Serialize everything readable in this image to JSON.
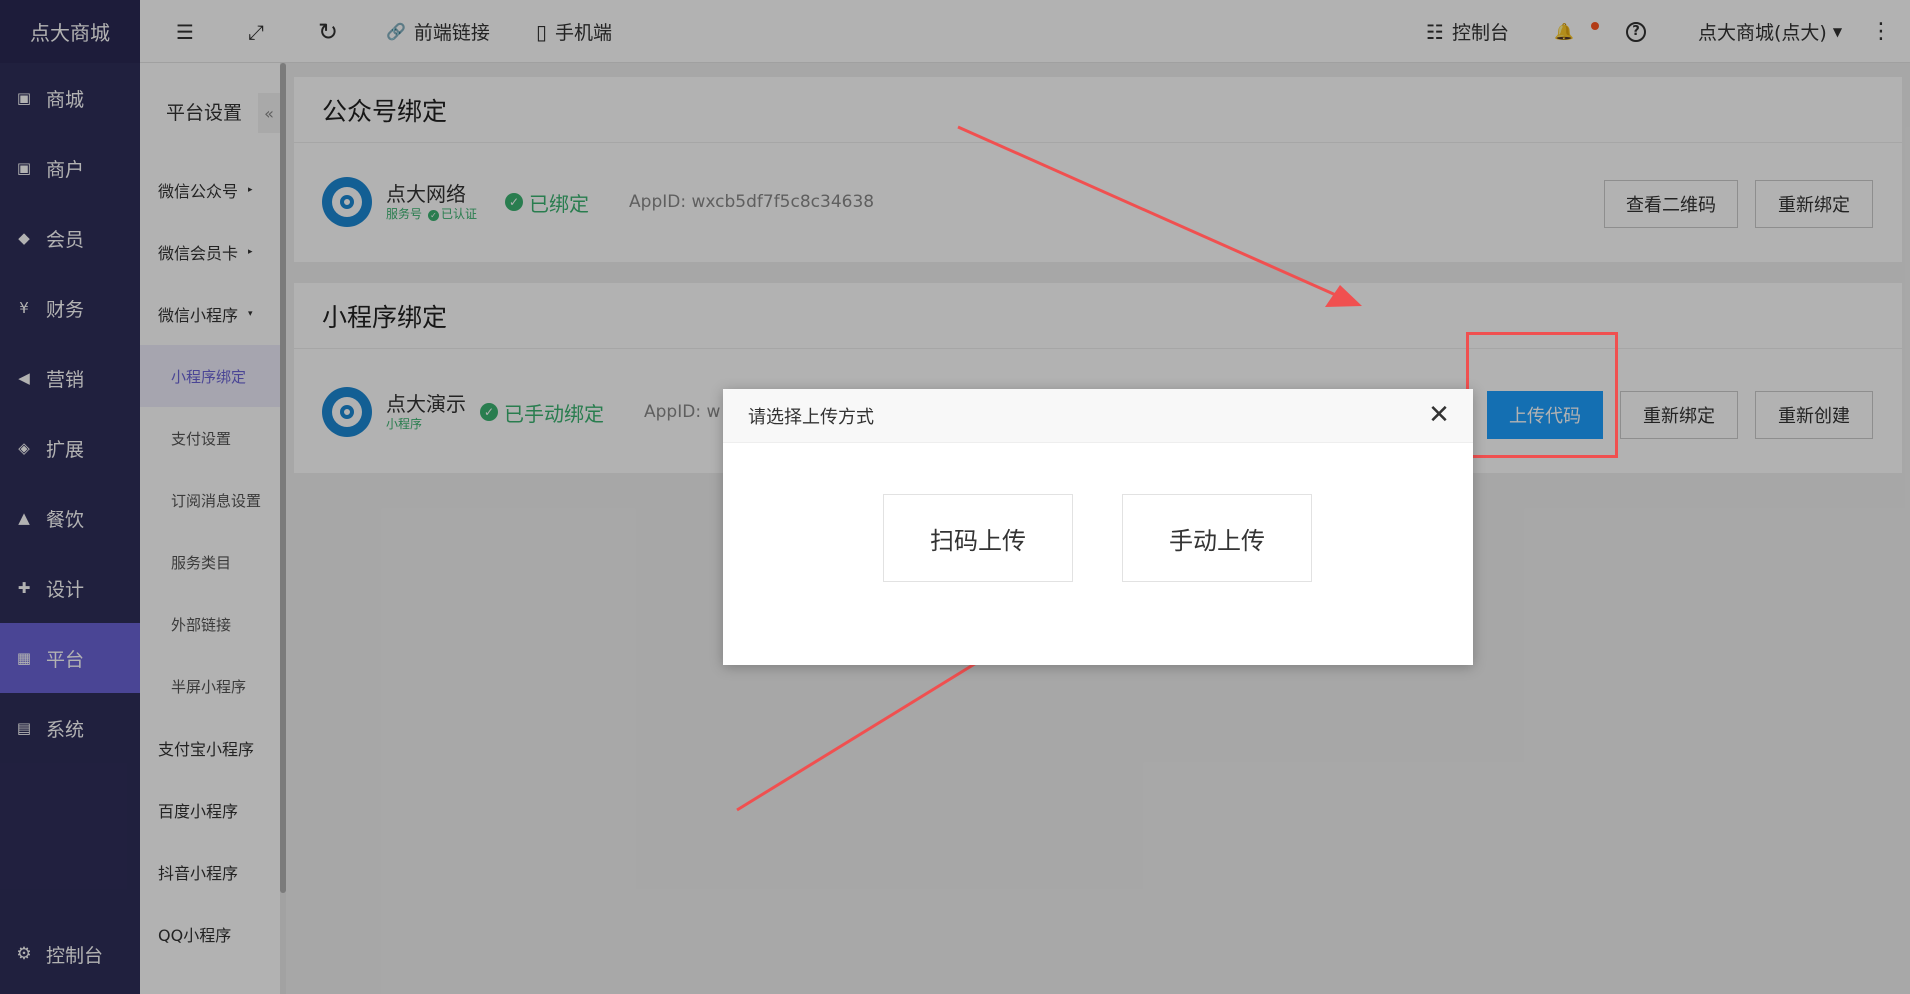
{
  "app": {
    "brand": "点大商城"
  },
  "leftnav": {
    "items": [
      {
        "label": "商城",
        "icon": "store-icon",
        "glyph": "▣"
      },
      {
        "label": "商户",
        "icon": "merchant-icon",
        "glyph": "▣"
      },
      {
        "label": "会员",
        "icon": "member-icon",
        "glyph": "◆"
      },
      {
        "label": "财务",
        "icon": "finance-icon",
        "glyph": "¥"
      },
      {
        "label": "营销",
        "icon": "megaphone-icon",
        "glyph": "◀"
      },
      {
        "label": "扩展",
        "icon": "cube-icon",
        "glyph": "◈"
      },
      {
        "label": "餐饮",
        "icon": "dining-icon",
        "glyph": "▲"
      },
      {
        "label": "设计",
        "icon": "puzzle-icon",
        "glyph": "✚"
      },
      {
        "label": "平台",
        "icon": "grid-icon",
        "glyph": "▦"
      },
      {
        "label": "系统",
        "icon": "monitor-icon",
        "glyph": "▤"
      }
    ],
    "active_index": 8,
    "bottom": {
      "label": "控制台",
      "icon": "gear-icon",
      "glyph": "⚙"
    }
  },
  "topbar": {
    "menu_glyph": "☰",
    "fullscreen_glyph": "⤢",
    "refresh_glyph": "↻",
    "link_glyph": "🔗",
    "frontend_link": "前端链接",
    "mobile_glyph": "▯",
    "mobile": "手机端",
    "console_glyph": "☷",
    "console": "控制台",
    "bell_glyph": "🔔",
    "help_glyph": "?",
    "user": "点大商城(点大)",
    "caret": "▼",
    "more_glyph": "⋮"
  },
  "submenu": {
    "title": "平台设置",
    "collapse_glyph": "«",
    "items": [
      {
        "label": "微信公众号",
        "arrow": "▸"
      },
      {
        "label": "微信会员卡",
        "arrow": "▸"
      },
      {
        "label": "微信小程序",
        "arrow": "▾"
      }
    ],
    "children": [
      "小程序绑定",
      "支付设置",
      "订阅消息设置",
      "服务类目",
      "外部链接",
      "半屏小程序"
    ],
    "active_child": 0,
    "others": [
      "支付宝小程序",
      "百度小程序",
      "抖音小程序",
      "QQ小程序"
    ]
  },
  "official_account": {
    "section_title": "公众号绑定",
    "name": "点大网络",
    "type": "服务号",
    "verified_glyph": "✓",
    "verified": "已认证",
    "status_glyph": "✓",
    "status": "已绑定",
    "appid": "AppID:  wxcb5df7f5c8c34638",
    "buttons": [
      "查看二维码",
      "重新绑定"
    ]
  },
  "mini_program": {
    "section_title": "小程序绑定",
    "name": "点大演示",
    "type": "小程序",
    "status_glyph": "✓",
    "status": "已手动绑定",
    "appid": "AppID:  w",
    "buttons": [
      "上传代码",
      "重新绑定",
      "重新创建"
    ]
  },
  "modal": {
    "title": "请选择上传方式",
    "close_glyph": "✕",
    "options": [
      "扫码上传",
      "手动上传"
    ]
  },
  "colors": {
    "nav_bg": "#2f2e5a",
    "nav_active": "#6a63d6",
    "primary": "#1e9fff",
    "success": "#3cb371",
    "annotation": "#f05050",
    "badge": "#ff5722"
  }
}
